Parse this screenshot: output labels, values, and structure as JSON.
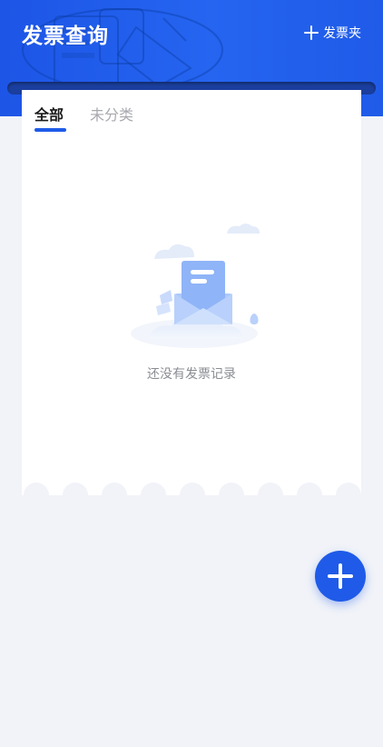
{
  "header": {
    "title": "发票查询",
    "add_folder_label": "发票夹",
    "background_color": "#1f5be8"
  },
  "tabs": [
    {
      "label": "全部",
      "active": true
    },
    {
      "label": "未分类",
      "active": false
    }
  ],
  "empty_state": {
    "message": "还没有发票记录",
    "icon": "empty-envelope-illustration"
  },
  "fab": {
    "icon": "plus-icon",
    "color": "#1f5be8"
  },
  "colors": {
    "accent": "#1f5be8",
    "page_background": "#f1f3f8"
  }
}
